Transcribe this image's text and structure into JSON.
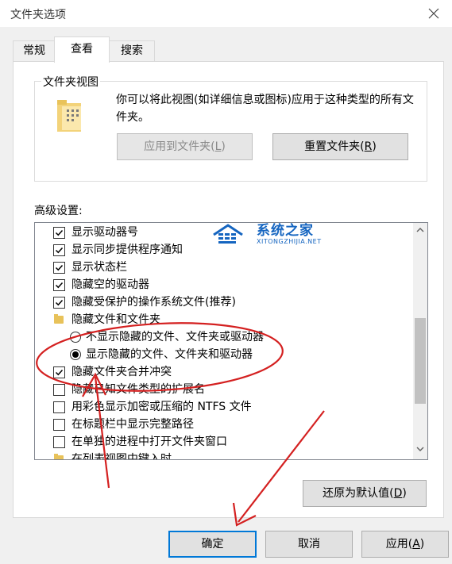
{
  "window": {
    "title": "文件夹选项"
  },
  "tabs": [
    {
      "label": "常规"
    },
    {
      "label": "查看"
    },
    {
      "label": "搜索"
    }
  ],
  "folder_view": {
    "label": "文件夹视图",
    "description": "你可以将此视图(如详细信息或图标)应用于这种类型的所有文件夹。",
    "apply_button": {
      "text": "应用到文件夹(",
      "key": "L",
      "suffix": ")"
    },
    "reset_button": {
      "text": "重置文件夹(",
      "key": "R",
      "suffix": ")"
    }
  },
  "advanced": {
    "label": "高级设置:",
    "items": [
      {
        "type": "checkbox",
        "checked": true,
        "label": "显示驱动器号"
      },
      {
        "type": "checkbox",
        "checked": true,
        "label": "显示同步提供程序通知"
      },
      {
        "type": "checkbox",
        "checked": true,
        "label": "显示状态栏"
      },
      {
        "type": "checkbox",
        "checked": true,
        "label": "隐藏空的驱动器"
      },
      {
        "type": "checkbox",
        "checked": true,
        "label": "隐藏受保护的操作系统文件(推荐)"
      },
      {
        "type": "folder",
        "label": "隐藏文件和文件夹"
      },
      {
        "type": "radio",
        "checked": false,
        "label": "不显示隐藏的文件、文件夹或驱动器"
      },
      {
        "type": "radio",
        "checked": true,
        "label": "显示隐藏的文件、文件夹和驱动器"
      },
      {
        "type": "checkbox",
        "checked": true,
        "label": "隐藏文件夹合并冲突"
      },
      {
        "type": "checkbox",
        "checked": false,
        "label": "隐藏已知文件类型的扩展名"
      },
      {
        "type": "checkbox",
        "checked": false,
        "label": "用彩色显示加密或压缩的 NTFS 文件"
      },
      {
        "type": "checkbox",
        "checked": false,
        "label": "在标题栏中显示完整路径"
      },
      {
        "type": "checkbox",
        "checked": false,
        "label": "在单独的进程中打开文件夹窗口"
      },
      {
        "type": "folder",
        "label": "在列表视图中键入时"
      }
    ],
    "restore_button": {
      "text": "还原为默认值(",
      "key": "D",
      "suffix": ")"
    }
  },
  "footer": {
    "ok": "确定",
    "cancel": "取消",
    "apply": {
      "text": "应用(",
      "key": "A",
      "suffix": ")"
    }
  },
  "watermark": {
    "text": "系统之家",
    "sub": "XITONGZHIJIA.NET"
  },
  "colors": {
    "annotation": "#d42020",
    "accent": "#0078d7",
    "watermark": "#1565c0"
  }
}
